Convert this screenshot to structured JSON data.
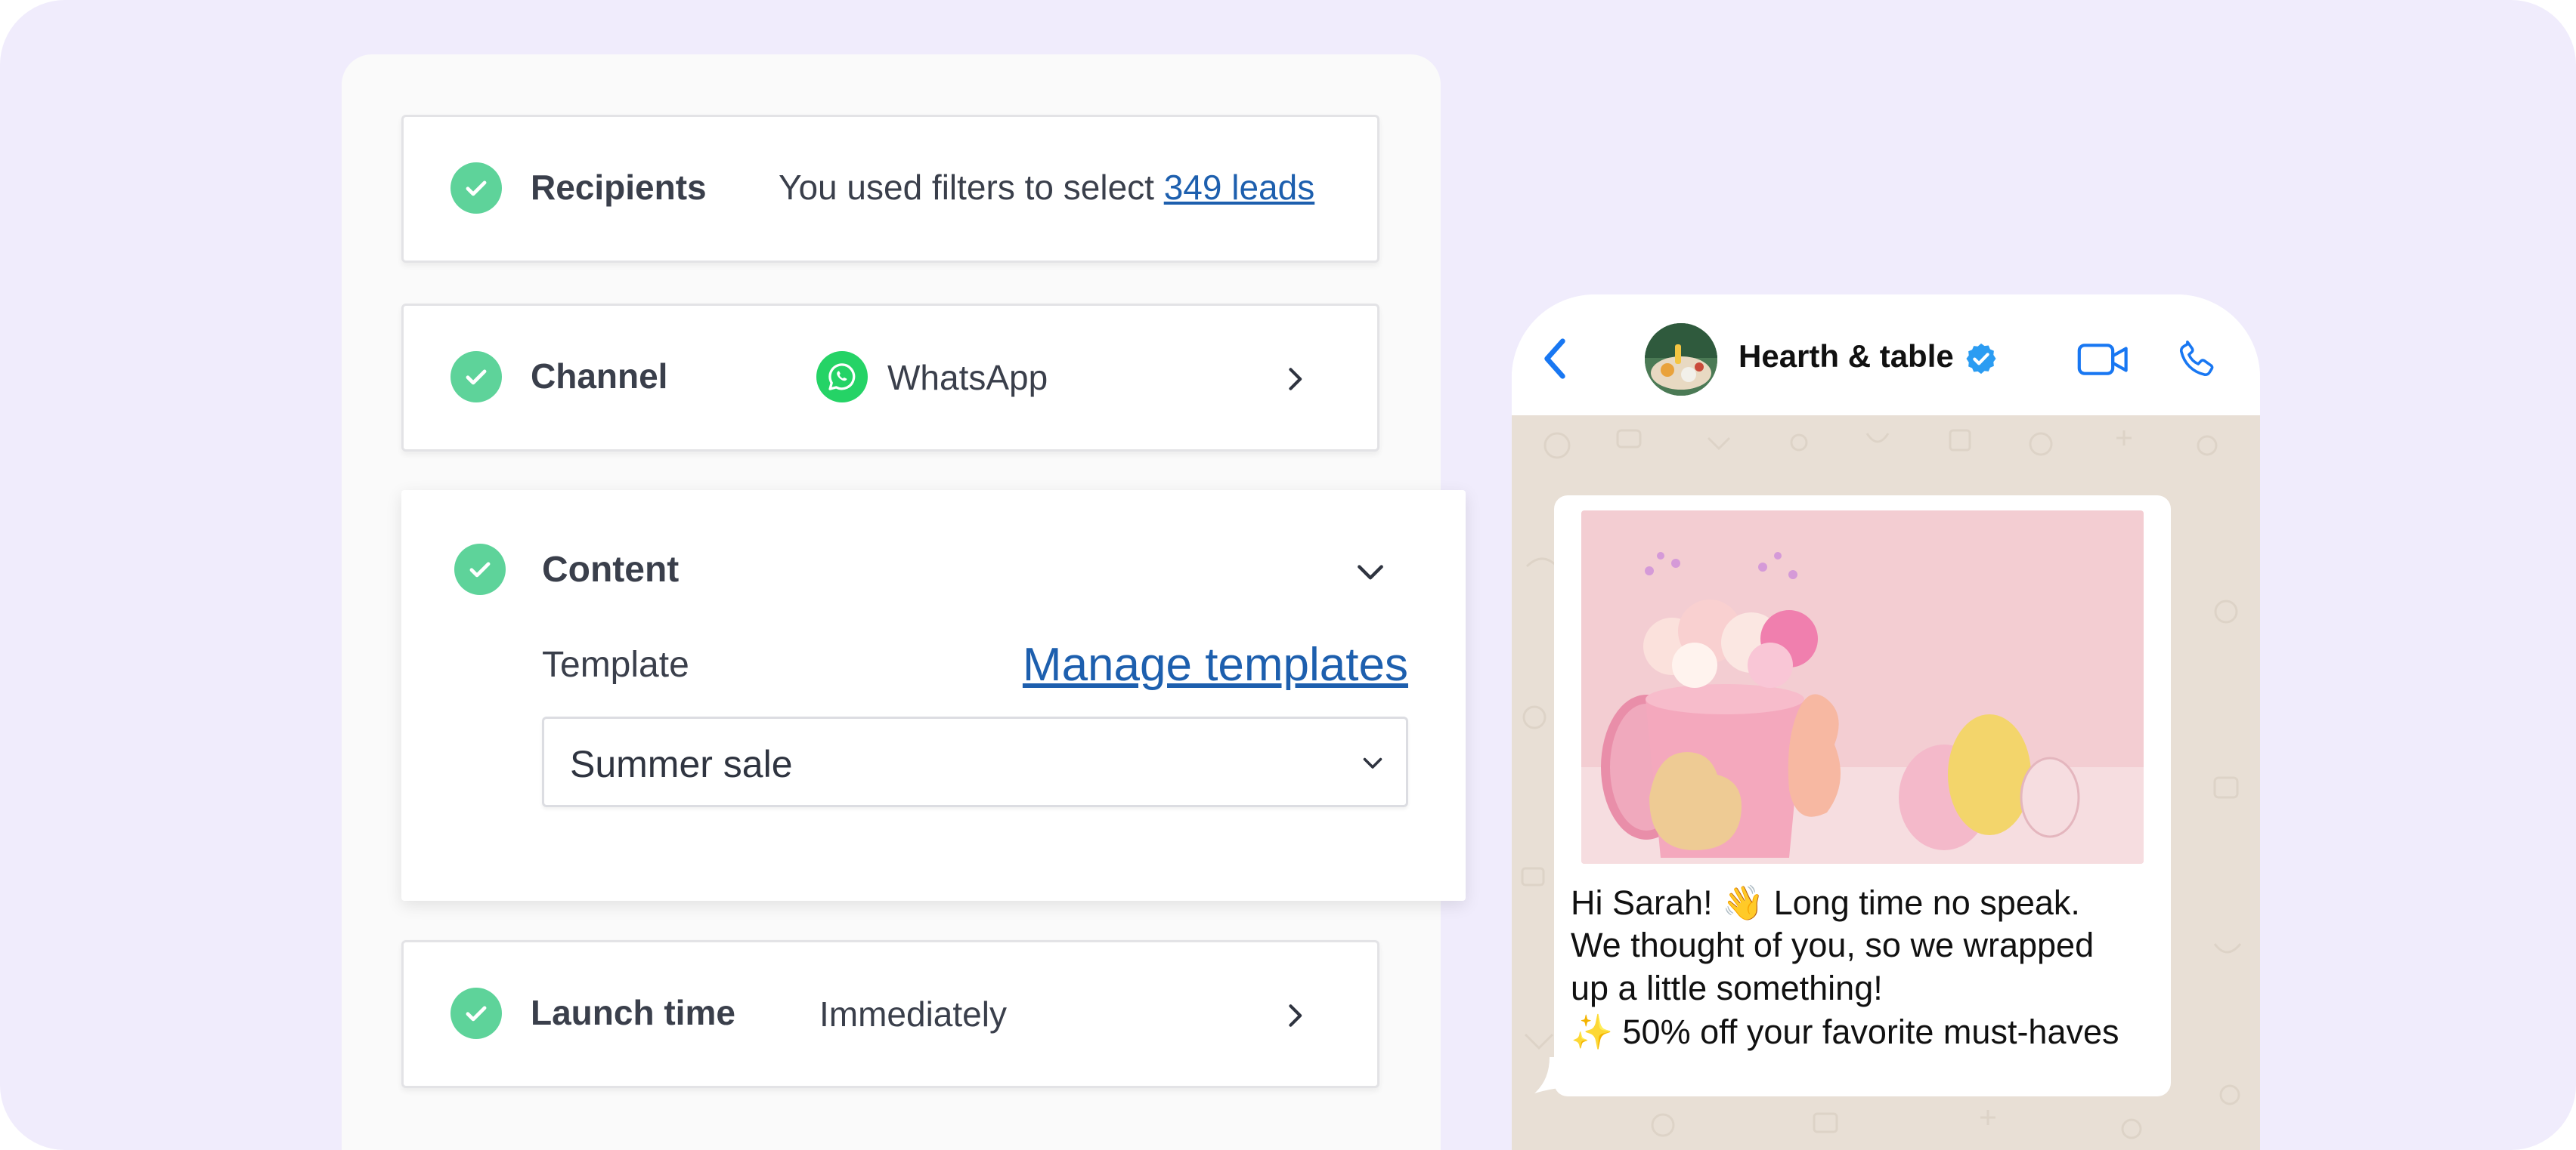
{
  "campaign": {
    "recipients": {
      "title": "Recipients",
      "text": "You used filters to select",
      "link": "349 leads"
    },
    "channel": {
      "title": "Channel",
      "value": "WhatsApp",
      "icon": "whatsapp-icon"
    },
    "content": {
      "title": "Content",
      "template_label": "Template",
      "manage_link": "Manage templates",
      "selected_template": "Summer sale"
    },
    "launch": {
      "title": "Launch time",
      "value": "Immediately"
    }
  },
  "phone": {
    "contact_name": "Hearth & table",
    "verified": true,
    "message_lines": [
      "Hi Sarah! 👋 Long time no speak.",
      "We thought of you, so we wrapped",
      "up a little something!",
      "✨ 50% off your favorite must-haves"
    ]
  },
  "colors": {
    "background": "#f0ecfc",
    "check": "#5ed39a",
    "link": "#1d5fae",
    "whatsapp": "#25d366",
    "phone_accent": "#1877f2",
    "chat_background": "#e8dfd5"
  }
}
